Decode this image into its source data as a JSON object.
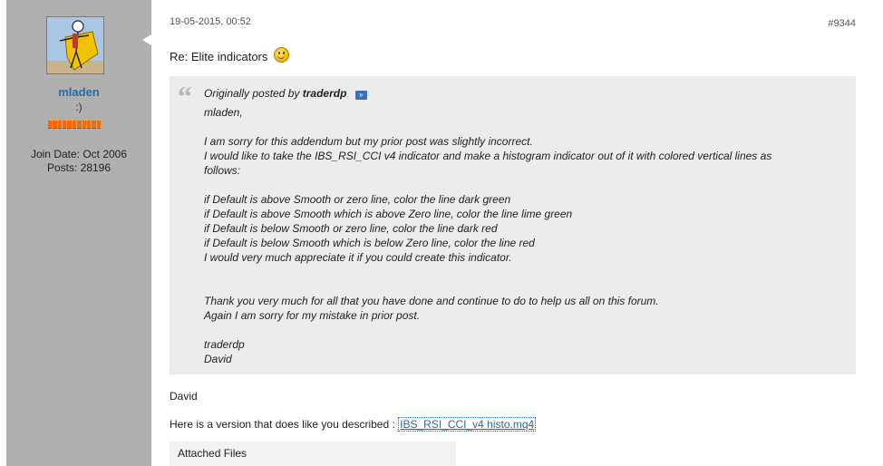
{
  "user": {
    "name": "mladen",
    "title": ":)",
    "join_date": "Join Date: Oct 2006",
    "posts": "Posts: 28196"
  },
  "post": {
    "date": "19-05-2015, 00:52",
    "number": "#9344",
    "title": "Re: Elite indicators",
    "smiley_icon": "smile-icon"
  },
  "quote": {
    "prefix": "Originally posted by",
    "author": "traderdp",
    "lines": [
      "mladen,",
      "",
      "I am sorry for this addendum but my prior post was slightly incorrect.",
      "I would like to take the IBS_RSI_CCI v4 indicator and make a histogram indicator out of it with colored vertical lines as",
      "follows:",
      "",
      "if Default is above Smooth or zero line, color the line dark green",
      "if Default is above Smooth which is above Zero line, color the line lime green",
      "if Default is below Smooth or zero line, color the line dark red",
      "if Default is below Smooth which is below Zero line, color the line red",
      "I would very much appreciate it if you could create this indicator.",
      "",
      "",
      "Thank you very much for all that you have done and continue to do to help us all on this forum.",
      "Again I am sorry for my mistake in prior post.",
      "",
      "traderdp",
      "David"
    ]
  },
  "body": {
    "signature": "David",
    "version_text": "Here is a version that does like you described :",
    "attachment_link": "IBS_RSI_CCI_v4 histo.mq4",
    "attached_files_label": "Attached Files"
  },
  "colors": {
    "user_column": "#b0b0b0",
    "quote_bg": "#ececec",
    "link": "#2a6aa8",
    "reputation": "#ff6a00"
  }
}
